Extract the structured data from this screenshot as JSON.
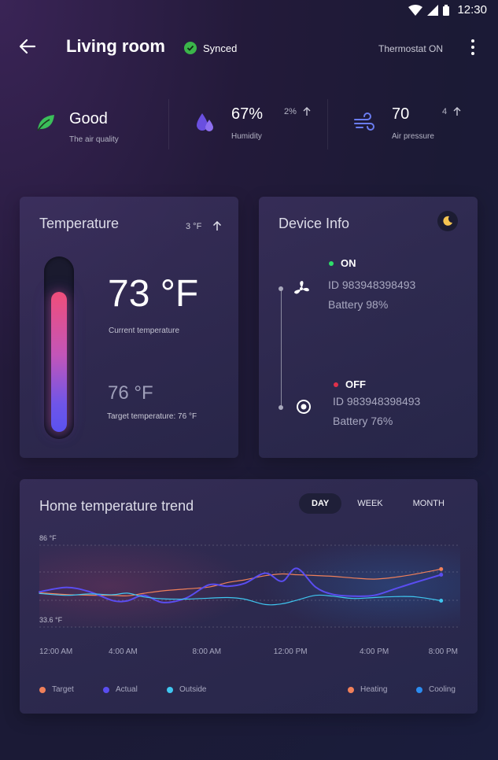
{
  "status_bar": {
    "time": "12:30"
  },
  "header": {
    "title": "Living room",
    "sync_label": "Synced",
    "thermostat_status": "Thermostat ON"
  },
  "stats": [
    {
      "value": "Good",
      "label": "The air quality",
      "delta": "",
      "icon": "leaf-icon"
    },
    {
      "value": "67%",
      "label": "Humidity",
      "delta": "2%",
      "icon": "water-drops-icon"
    },
    {
      "value": "70",
      "label": "Air pressure",
      "delta": "4",
      "icon": "wind-icon"
    }
  ],
  "temperature_card": {
    "title": "Temperature",
    "delta": "3 °F",
    "current": "73 °F",
    "current_label": "Current temperature",
    "target": "76 °F",
    "target_label": "Target temperature: 76 °F"
  },
  "device_card": {
    "title": "Device Info",
    "devices": [
      {
        "state": "ON",
        "state_color": "#2ee06a",
        "id": "ID 983948398493",
        "battery": "Battery 98%",
        "icon": "fan-icon"
      },
      {
        "state": "OFF",
        "state_color": "#e0304a",
        "id": "ID 983948398493",
        "battery": "Battery 76%",
        "icon": "target-icon"
      }
    ]
  },
  "trend_card": {
    "title": "Home temperature trend",
    "tabs": [
      "DAY",
      "WEEK",
      "MONTH"
    ],
    "active_tab": "DAY",
    "legend": [
      {
        "label": "Target",
        "color": "#f0805a"
      },
      {
        "label": "Actual",
        "color": "#5a4df0"
      },
      {
        "label": "Outside",
        "color": "#3fc6f0"
      },
      {
        "label": "Heating",
        "color": "#f0805a"
      },
      {
        "label": "Cooling",
        "color": "#2b8cf0"
      }
    ]
  },
  "chart_data": {
    "type": "line",
    "y_ticks": [
      "86 °F",
      "33.6 °F"
    ],
    "x_ticks": [
      "12:00 AM",
      "4:00 AM",
      "8:00 AM",
      "12:00 PM",
      "4:00 PM",
      "8:00 PM"
    ],
    "ylim": [
      33.6,
      86
    ],
    "x_hours": [
      0,
      1.3,
      2.4,
      3.5,
      4.2,
      5.0,
      5.9,
      7.0,
      8.1,
      9.0,
      9.8,
      10.8,
      11.6,
      12.3,
      13.2,
      14.0,
      15.0,
      16.0,
      17.0,
      18.0,
      19.2
    ],
    "series": [
      {
        "name": "Target",
        "color": "#f0805a",
        "values": [
          55.6,
          54.4,
          54.0,
          53.9,
          53.6,
          55.2,
          56.8,
          58.0,
          59.2,
          62.1,
          63.8,
          66.5,
          67.6,
          67.1,
          66.6,
          66.1,
          65.0,
          64.3,
          65.5,
          67.6,
          70.7
        ]
      },
      {
        "name": "Actual",
        "color": "#5a4df0",
        "values": [
          56.1,
          59.0,
          56.2,
          50.6,
          50.4,
          53.9,
          49.3,
          52.1,
          60.6,
          59.7,
          61.5,
          68.1,
          62.9,
          71.2,
          59.2,
          54.6,
          53.4,
          53.9,
          58.1,
          62.3,
          67.1
        ]
      },
      {
        "name": "Outside",
        "color": "#3fc6f0",
        "values": [
          55.1,
          53.9,
          54.8,
          54.3,
          55.3,
          52.9,
          51.7,
          51.5,
          52.1,
          52.5,
          51.5,
          48.0,
          48.5,
          50.8,
          53.9,
          53.4,
          51.9,
          52.5,
          53.1,
          52.9,
          50.5
        ]
      }
    ]
  }
}
